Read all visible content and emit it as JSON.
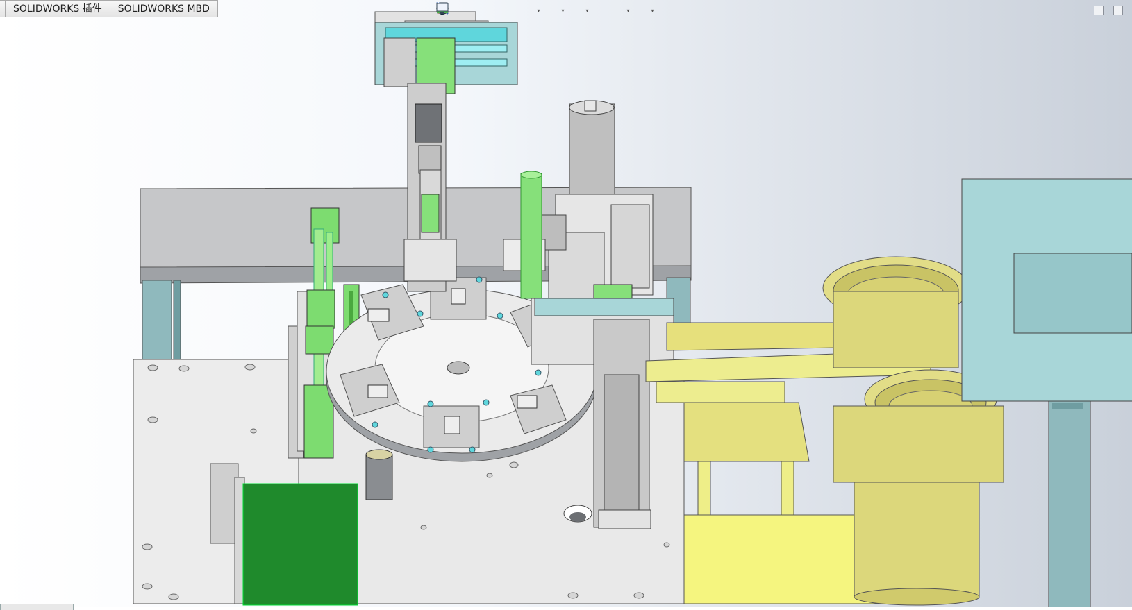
{
  "command_tabs": [
    {
      "label": ""
    },
    {
      "label": "SOLIDWORKS 插件"
    },
    {
      "label": "SOLIDWORKS MBD"
    }
  ],
  "heads_up_toolbar": [
    {
      "icon": "zoom-to-fit-icon"
    },
    {
      "icon": "zoom-to-area-icon"
    },
    {
      "icon": "previous-view-icon"
    },
    {
      "icon": "section-view-icon"
    },
    {
      "icon": "dynamic-annotation-icon"
    },
    {
      "icon": "view-orientation-icon",
      "dropdown": true
    },
    {
      "icon": "display-style-icon",
      "dropdown": true
    },
    {
      "icon": "hide-show-items-icon",
      "dropdown": true
    },
    {
      "icon": "edit-appearance-icon"
    },
    {
      "icon": "apply-scene-icon",
      "dropdown": true
    },
    {
      "icon": "view-settings-icon",
      "dropdown": true
    }
  ],
  "window_controls": [
    {
      "icon": "restore-window-icon"
    },
    {
      "icon": "maximize-window-icon"
    }
  ],
  "colors": {
    "background_left": "#ffffff",
    "background_right": "#c9d0da",
    "plate_grey": "#e9e9e9",
    "steel_grey": "#bfc2c6",
    "teal_guard": "#a8d6d8",
    "cyan_accent": "#5fd6dc",
    "green_cylinder": "#86e07a",
    "dark_green_conveyor": "#1f8a2c",
    "yellow_feeder": "#eded8f",
    "bowl_yellow": "#dcd77b"
  }
}
